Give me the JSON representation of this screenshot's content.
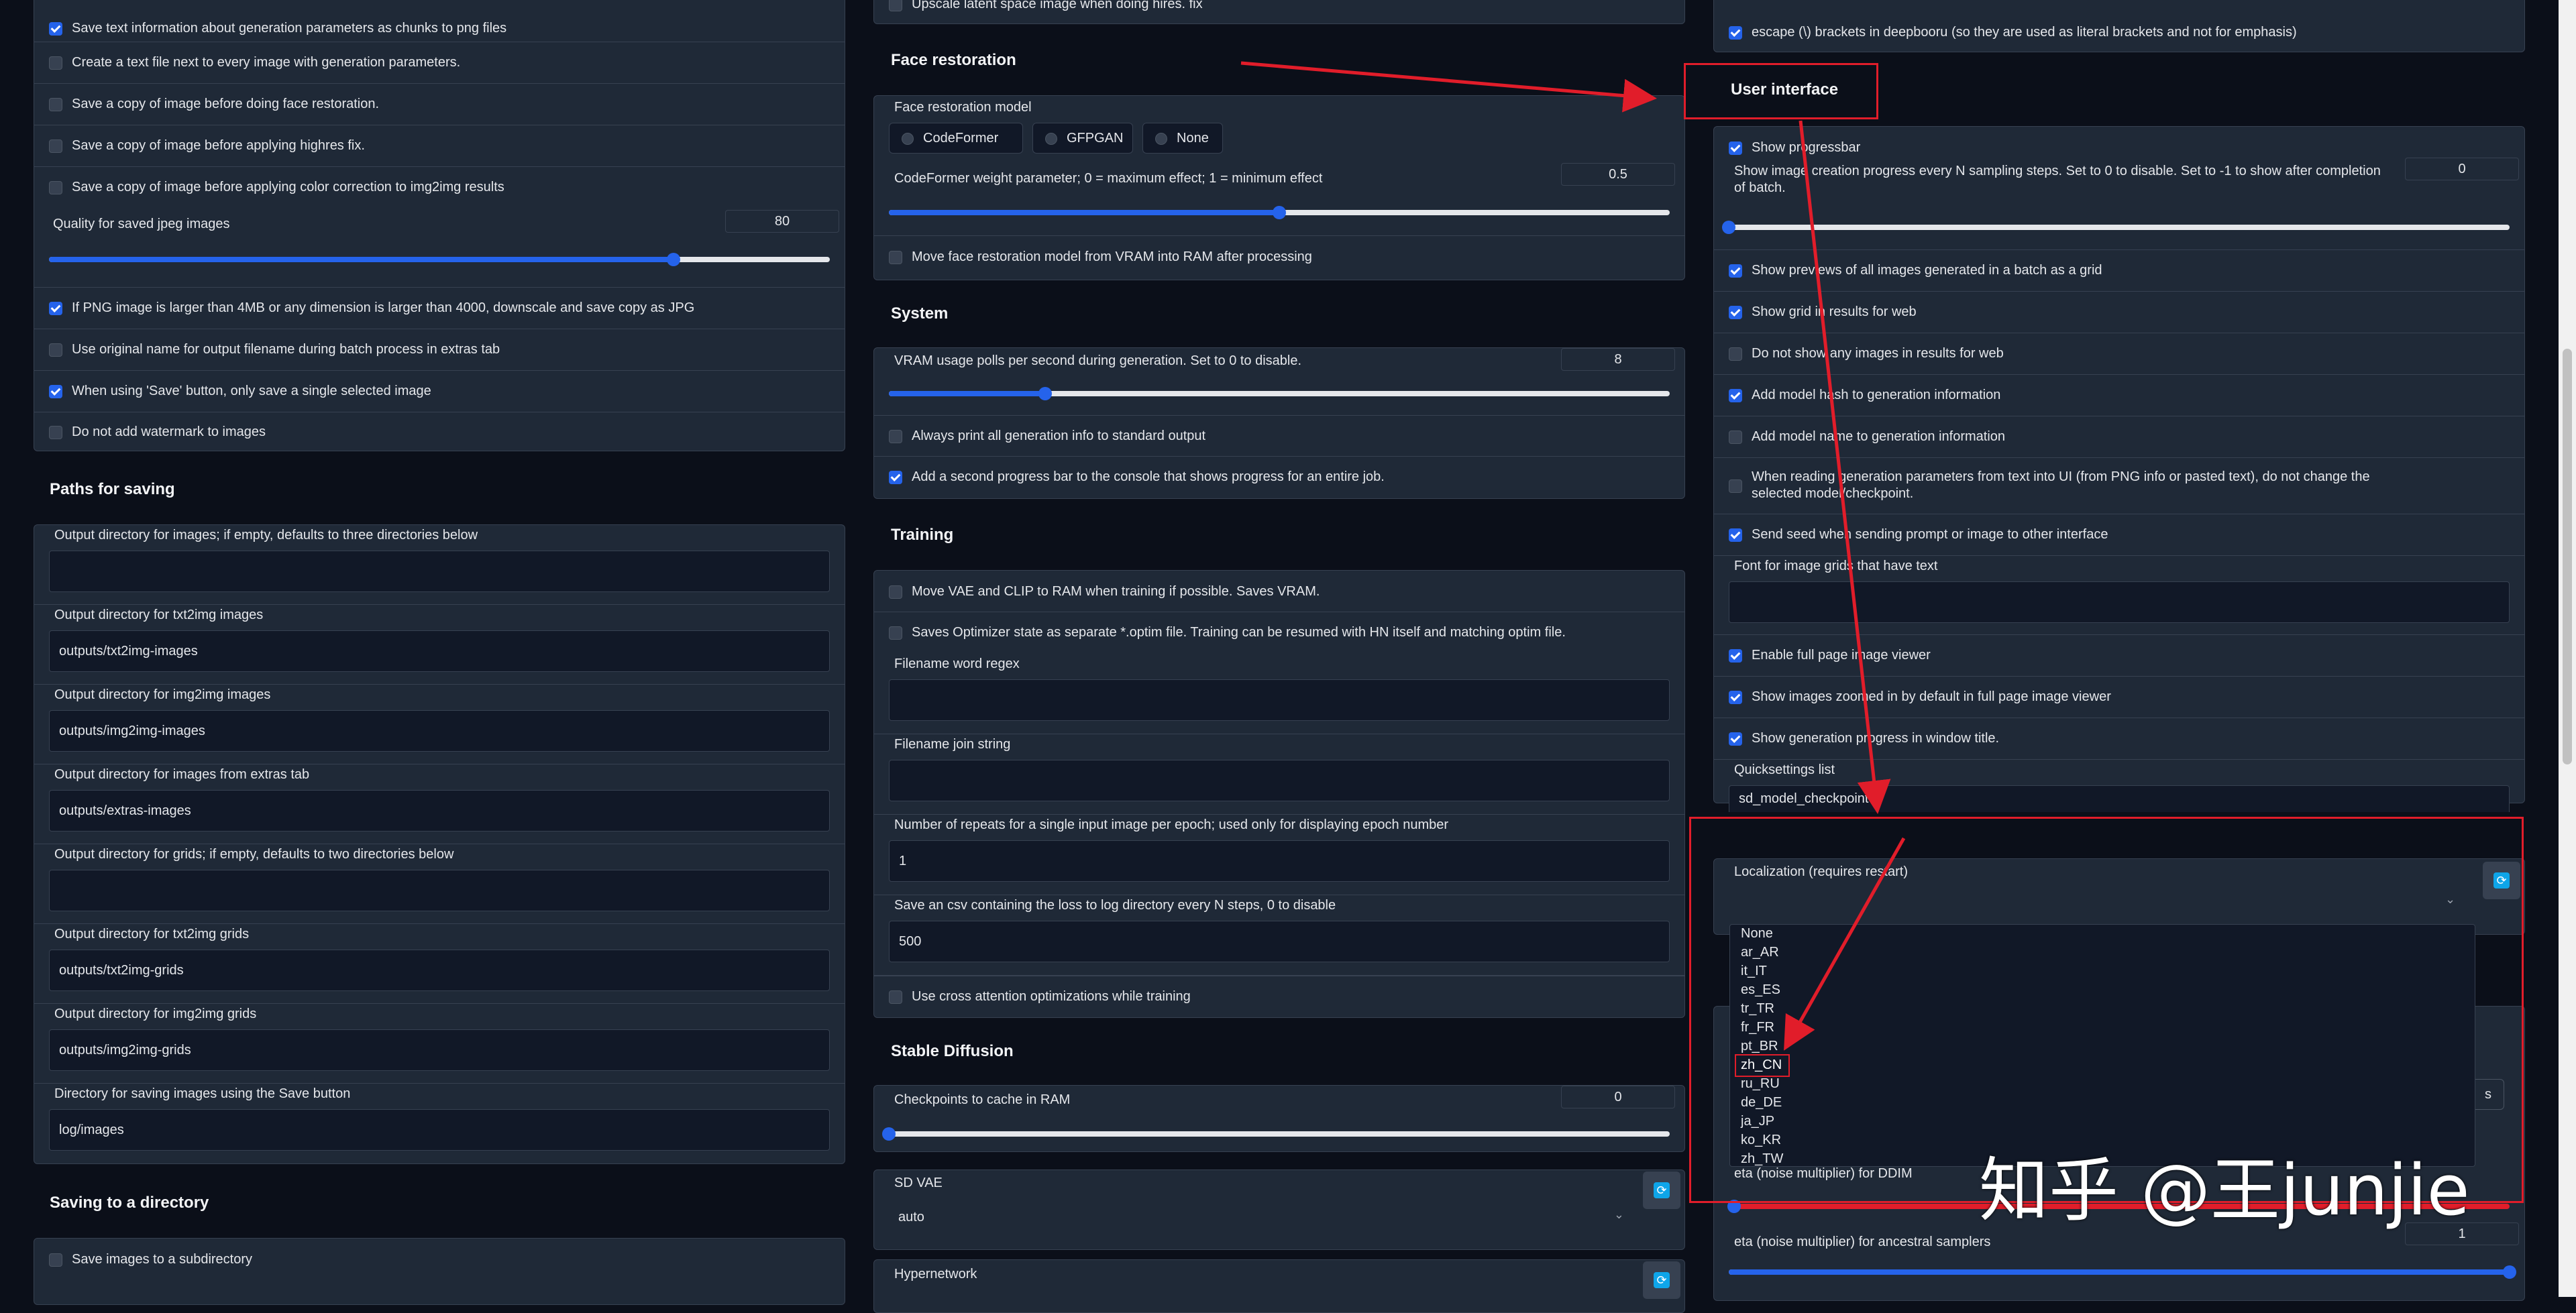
{
  "left": {
    "top_checks": [
      {
        "label": "Save text information about generation parameters as chunks to png files",
        "checked": true
      },
      {
        "label": "Create a text file next to every image with generation parameters.",
        "checked": false
      },
      {
        "label": "Save a copy of image before doing face restoration.",
        "checked": false
      },
      {
        "label": "Save a copy of image before applying highres fix.",
        "checked": false
      },
      {
        "label": "Save a copy of image before applying color correction to img2img results",
        "checked": false
      }
    ],
    "jpeg_quality": {
      "label": "Quality for saved jpeg images",
      "value": "80",
      "fraction": 0.8
    },
    "more_checks": [
      {
        "label": "If PNG image is larger than 4MB or any dimension is larger than 4000, downscale and save copy as JPG",
        "checked": true
      },
      {
        "label": "Use original name for output filename during batch process in extras tab",
        "checked": false
      },
      {
        "label": "When using 'Save' button, only save a single selected image",
        "checked": true
      },
      {
        "label": "Do not add watermark to images",
        "checked": false
      }
    ],
    "paths_header": "Paths for saving",
    "paths": [
      {
        "label": "Output directory for images; if empty, defaults to three directories below",
        "value": ""
      },
      {
        "label": "Output directory for txt2img images",
        "value": "outputs/txt2img-images"
      },
      {
        "label": "Output directory for img2img images",
        "value": "outputs/img2img-images"
      },
      {
        "label": "Output directory for images from extras tab",
        "value": "outputs/extras-images"
      },
      {
        "label": "Output directory for grids; if empty, defaults to two directories below",
        "value": ""
      },
      {
        "label": "Output directory for txt2img grids",
        "value": "outputs/txt2img-grids"
      },
      {
        "label": "Output directory for img2img grids",
        "value": "outputs/img2img-grids"
      },
      {
        "label": "Directory for saving images using the Save button",
        "value": "log/images"
      }
    ],
    "saving_dir_header": "Saving to a directory",
    "saving_dir_checks": [
      {
        "label": "Save images to a subdirectory",
        "checked": false
      }
    ]
  },
  "middle": {
    "top_partial": "Upscale latent space image when doing hires. fix",
    "face_header": "Face restoration",
    "face_model_label": "Face restoration model",
    "face_models": [
      "CodeFormer",
      "GFPGAN",
      "None"
    ],
    "codeformer_weight": {
      "label": "CodeFormer weight parameter; 0 = maximum effect; 1 = minimum effect",
      "value": "0.5",
      "fraction": 0.5
    },
    "face_move": "Move face restoration model from VRAM into RAM after processing",
    "system_header": "System",
    "vram_polls": {
      "label": "VRAM usage polls per second during generation. Set to 0 to disable.",
      "value": "8",
      "fraction": 0.2
    },
    "system_checks": [
      {
        "label": "Always print all generation info to standard output",
        "checked": false
      },
      {
        "label": "Add a second progress bar to the console that shows progress for an entire job.",
        "checked": true
      }
    ],
    "training_header": "Training",
    "training_checks": [
      {
        "label": "Move VAE and CLIP to RAM when training if possible. Saves VRAM.",
        "checked": false
      },
      {
        "label": "Saves Optimizer state as separate *.optim file. Training can be resumed with HN itself and matching optim file.",
        "checked": false
      }
    ],
    "training_fields": [
      {
        "label": "Filename word regex",
        "value": ""
      },
      {
        "label": "Filename join string",
        "value": ""
      },
      {
        "label": "Number of repeats for a single input image per epoch; used only for displaying epoch number",
        "value": "1"
      },
      {
        "label": "Save an csv containing the loss to log directory every N steps, 0 to disable",
        "value": "500"
      }
    ],
    "cross_attn": "Use cross attention optimizations while training",
    "sd_header": "Stable Diffusion",
    "checkpoints_cache": {
      "label": "Checkpoints to cache in RAM",
      "value": "0",
      "fraction": 0.0
    },
    "sd_vae": {
      "label": "SD VAE",
      "value": "auto"
    },
    "hypernetwork_label": "Hypernetwork"
  },
  "right": {
    "escape_check": {
      "label": "escape (\\) brackets in deepbooru (so they are used as literal brackets and not for emphasis)",
      "checked": true
    },
    "ui_header": "User interface",
    "show_progressbar": {
      "label": "Show progressbar",
      "checked": true
    },
    "progress_steps": {
      "label": "Show image creation progress every N sampling steps. Set to 0 to disable. Set to -1 to show after completion of batch.",
      "value": "0",
      "fraction": 0.0
    },
    "ui_checks": [
      {
        "label": "Show previews of all images generated in a batch as a grid",
        "checked": true
      },
      {
        "label": "Show grid in results for web",
        "checked": true
      },
      {
        "label": "Do not show any images in results for web",
        "checked": false
      },
      {
        "label": "Add model hash to generation information",
        "checked": true
      },
      {
        "label": "Add model name to generation information",
        "checked": false
      },
      {
        "label": "When reading generation parameters from text into UI (from PNG info or pasted text), do not change the selected model/checkpoint.",
        "checked": false
      },
      {
        "label": "Send seed when sending prompt or image to other interface",
        "checked": true
      }
    ],
    "font_grids_label": "Font for image grids that have text",
    "viewer_checks": [
      {
        "label": "Enable full page image viewer",
        "checked": true
      },
      {
        "label": "Show images zoomed in by default in full page image viewer",
        "checked": true
      },
      {
        "label": "Show generation progress in window title.",
        "checked": true
      }
    ],
    "quicksettings_label": "Quicksettings list",
    "quicksettings_value": "sd_model_checkpoint",
    "localization_label": "Localization (requires restart)",
    "localization_options": [
      "None",
      "ar_AR",
      "it_IT",
      "es_ES",
      "tr_TR",
      "fr_FR",
      "pt_BR",
      "zh_CN",
      "ru_RU",
      "de_DE",
      "ja_JP",
      "ko_KR",
      "zh_TW"
    ],
    "highlighted_option": "zh_CN",
    "eta_ddim_label": "eta (noise multiplier) for DDIM",
    "eta_ancestral": {
      "label": "eta (noise multiplier) for ancestral samplers",
      "value": "1",
      "fraction": 1.0
    },
    "partial_s": "s"
  },
  "watermark": "知乎 @王junjie",
  "colors": {
    "accent": "#2563eb",
    "annotation": "#e11d2a",
    "bg": "#0b0f19",
    "panel": "#1f2937"
  }
}
